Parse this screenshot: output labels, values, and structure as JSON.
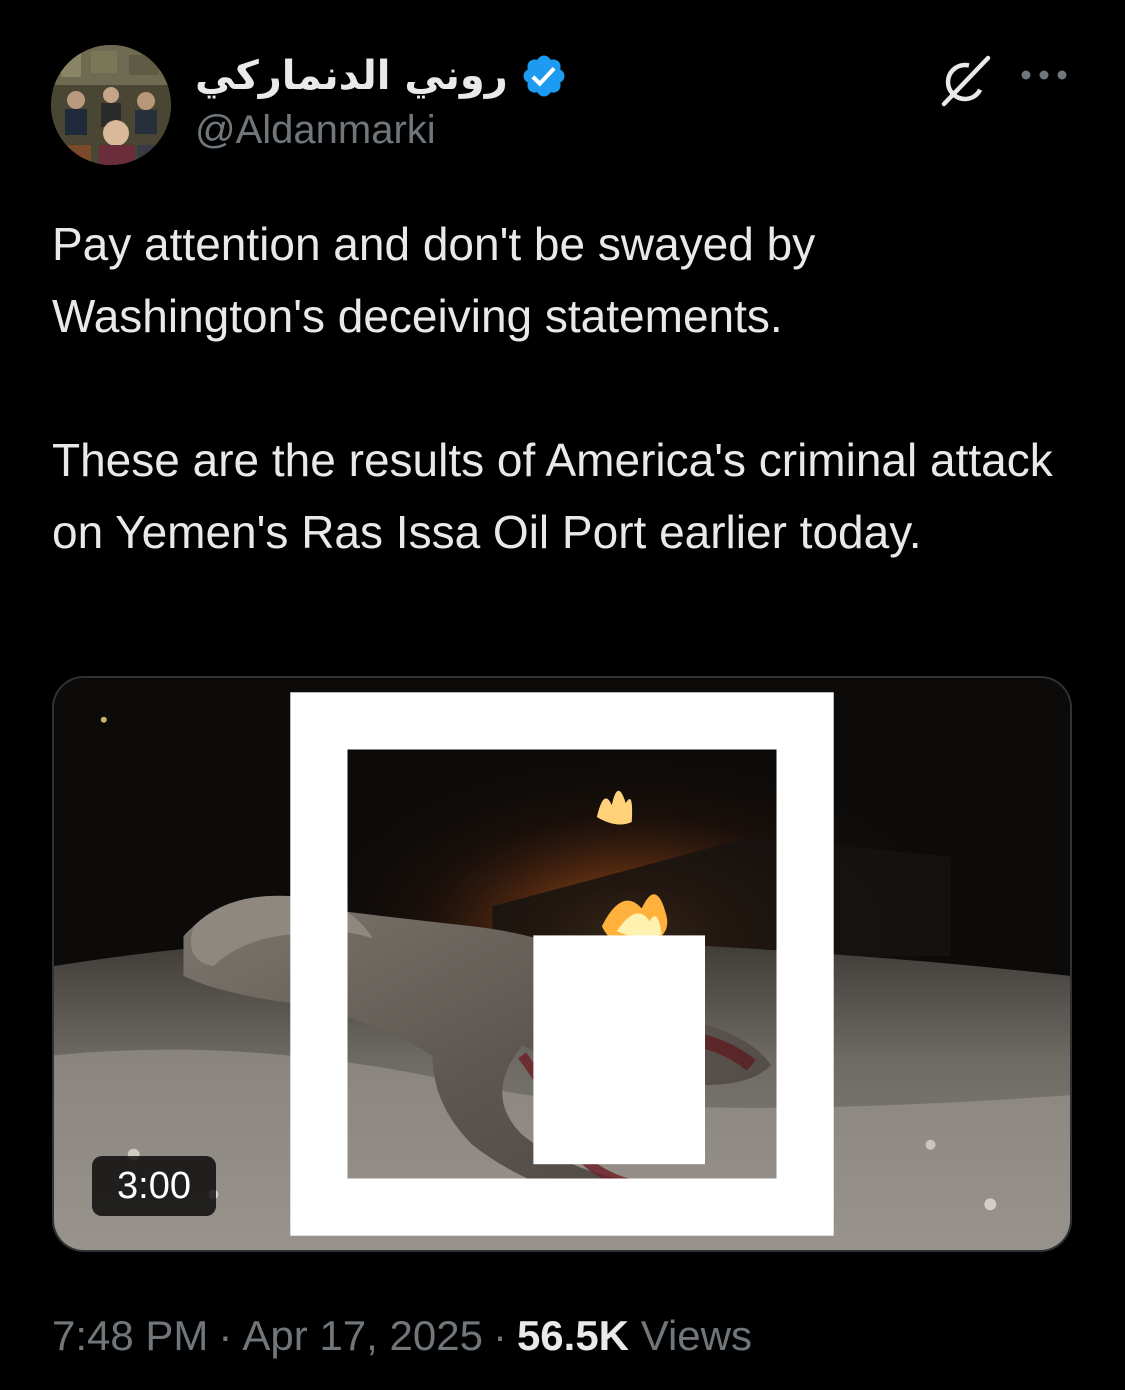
{
  "author": {
    "display_name": "روني الدنماركي",
    "handle": "@Aldanmarki",
    "verified": true,
    "verified_color": "#1d9bf0"
  },
  "header": {
    "grok_icon": "grok-icon",
    "more_icon": "more-horizontal-icon"
  },
  "tweet": {
    "paragraph_1": "Pay attention and don't be swayed by Washington's deceiving statements.",
    "paragraph_2": "These are the results of America's criminal attack on Yemen's Ras Issa Oil Port earlier today."
  },
  "media": {
    "type": "video",
    "duration": "3:00"
  },
  "meta": {
    "time": "7:48 PM",
    "separator": "·",
    "date": "Apr 17, 2025",
    "views_count": "56.5K",
    "views_label": "Views"
  },
  "colors": {
    "background": "#000000",
    "text_primary": "#e7e9ea",
    "text_secondary": "#71767b",
    "border": "#2f3336"
  }
}
